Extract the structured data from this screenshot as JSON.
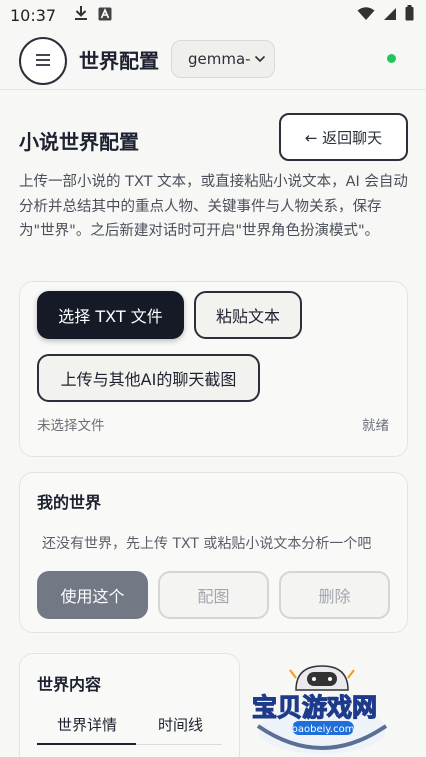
{
  "status_bar": {
    "time": "10:37",
    "icons_left": [
      "download-icon",
      "a-badge-icon"
    ],
    "icons_right": [
      "wifi-icon",
      "cellular-icon",
      "battery-icon"
    ]
  },
  "header": {
    "title": "世界配置",
    "model_select": {
      "value": "gemma-"
    },
    "status_color": "#22c55e"
  },
  "page": {
    "title": "小说世界配置",
    "back_button": "← 返回聊天",
    "intro": "上传一部小说的 TXT 文本，或直接粘贴小说文本，AI 会自动分析并总结其中的重点人物、关键事件与人物关系，保存为\"世界\"。之后新建对话时可开启\"世界角色扮演模式\"。"
  },
  "upload": {
    "select_txt": "选择 TXT 文件",
    "paste_text": "粘贴文本",
    "upload_chat": "上传与其他AI的聊天截图",
    "file_status": "未选择文件",
    "ready_status": "就绪"
  },
  "worlds": {
    "title": "我的世界",
    "empty": "还没有世界，先上传 TXT 或粘贴小说文本分析一个吧",
    "use_button": "使用这个",
    "illustrate_button": "配图",
    "delete_button": "删除"
  },
  "content": {
    "title": "世界内容",
    "tabs": [
      "世界详情",
      "时间线"
    ]
  },
  "watermark": {
    "text": "宝贝游戏网",
    "url": "baobeiy.com"
  }
}
